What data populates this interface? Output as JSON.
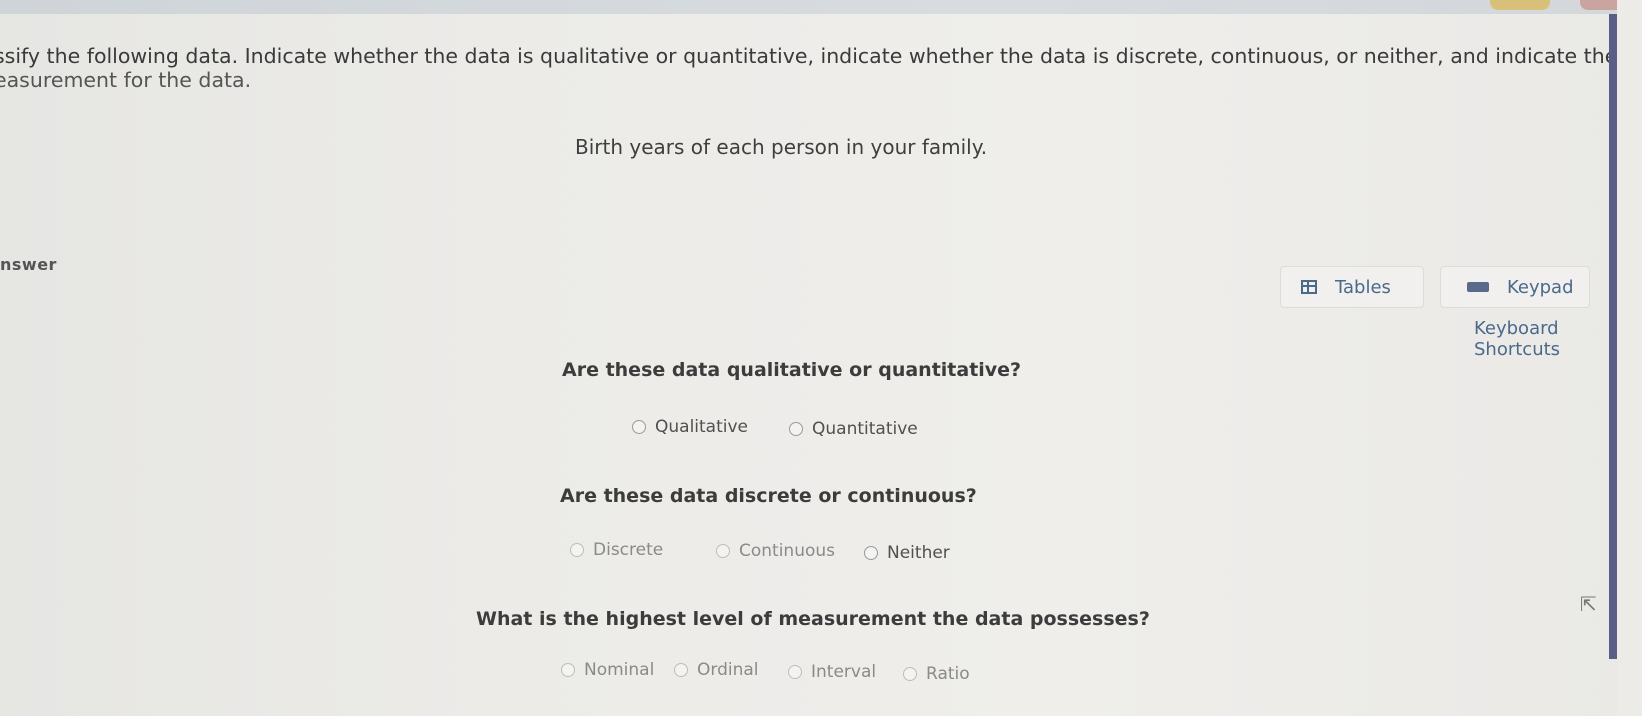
{
  "instructions": {
    "line1": "ssify the following data. Indicate whether the data is qualitative or quantitative, indicate whether the data is discrete, continuous, or neither, and indicate the level of",
    "line2": "easurement for the data."
  },
  "prompt": "Birth years of each person in your family.",
  "answer_label": "nswer",
  "tools": {
    "tables": "Tables",
    "keypad": "Keypad",
    "shortcuts": "Keyboard Shortcuts"
  },
  "questions": [
    {
      "text": "Are these data qualitative or quantitative?",
      "options": [
        "Qualitative",
        "Quantitative"
      ]
    },
    {
      "text": "Are these data discrete or continuous?",
      "options": [
        "Discrete",
        "Continuous",
        "Neither"
      ]
    },
    {
      "text": "What is the highest level of measurement the data possesses?",
      "options": [
        "Nominal",
        "Ordinal",
        "Interval",
        "Ratio"
      ]
    }
  ],
  "icons": {
    "tables": "table-icon",
    "keypad": "keypad-icon",
    "cursor": "mouse-cursor-icon"
  },
  "colors": {
    "accent": "#4a6a8a",
    "side_bar": "#5a5e86"
  }
}
